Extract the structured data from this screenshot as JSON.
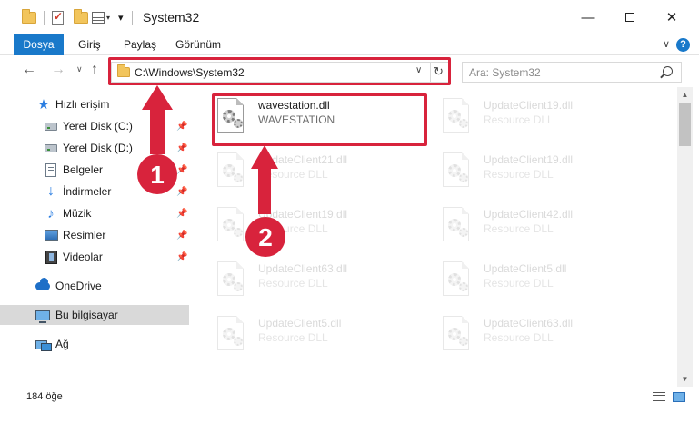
{
  "window": {
    "title": "System32",
    "minimize_icon": "minimize-icon",
    "maximize_icon": "maximize-icon",
    "close_icon": "close-icon"
  },
  "ribbon": {
    "tabs": [
      {
        "label": "Dosya",
        "active": true
      },
      {
        "label": "Giriş"
      },
      {
        "label": "Paylaş"
      },
      {
        "label": "Görünüm"
      }
    ],
    "help_label": "?"
  },
  "navbar": {
    "address": "C:\\Windows\\System32",
    "search_placeholder": "Ara: System32"
  },
  "sidebar": {
    "items": [
      {
        "label": "Hızlı erişim",
        "icon": "star-icon"
      },
      {
        "label": "Yerel Disk (C:)",
        "icon": "disk-icon",
        "pinned": true
      },
      {
        "label": "Yerel Disk (D:)",
        "icon": "disk-icon",
        "pinned": true
      },
      {
        "label": "Belgeler",
        "icon": "document-icon",
        "pinned": true
      },
      {
        "label": "İndirmeler",
        "icon": "download-icon",
        "pinned": true
      },
      {
        "label": "Müzik",
        "icon": "music-icon",
        "pinned": true
      },
      {
        "label": "Resimler",
        "icon": "pictures-icon",
        "pinned": true
      },
      {
        "label": "Videolar",
        "icon": "video-icon",
        "pinned": true
      },
      {
        "label": "OneDrive",
        "icon": "onedrive-icon"
      },
      {
        "label": "Bu bilgisayar",
        "icon": "computer-icon",
        "selected": true
      },
      {
        "label": "Ağ",
        "icon": "network-icon"
      }
    ]
  },
  "files": [
    {
      "name": "wavestation.dll",
      "desc": "WAVESTATION",
      "highlighted": true
    },
    {
      "name": "UpdateClient19.dll",
      "desc": "Resource DLL"
    },
    {
      "name": "UpdateClient21.dll",
      "desc": "Resource DLL"
    },
    {
      "name": "UpdateClient19.dll",
      "desc": "Resource DLL"
    },
    {
      "name": "UpdateClient19.dll",
      "desc": "Resource DLL"
    },
    {
      "name": "UpdateClient42.dll",
      "desc": "Resource DLL"
    },
    {
      "name": "UpdateClient63.dll",
      "desc": "Resource DLL"
    },
    {
      "name": "UpdateClient5.dll",
      "desc": "Resource DLL"
    },
    {
      "name": "UpdateClient5.dll",
      "desc": "Resource DLL"
    },
    {
      "name": "UpdateClient63.dll",
      "desc": "Resource DLL"
    }
  ],
  "status": {
    "item_count": "184 öğe"
  },
  "annotations": {
    "step1": "1",
    "step2": "2",
    "color": "#d8233c"
  },
  "colors": {
    "accent": "#1979ca",
    "highlight": "#d8233c",
    "selection": "#d9d9d9"
  }
}
